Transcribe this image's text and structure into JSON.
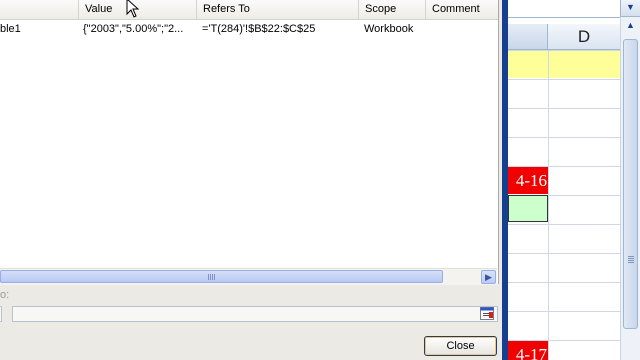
{
  "dialog": {
    "columns": [
      {
        "label": "Value"
      },
      {
        "label": "Refers To"
      },
      {
        "label": "Scope"
      },
      {
        "label": "Comment"
      }
    ],
    "rows": [
      {
        "name": "ble1",
        "value": "{\"2003\",\"5.00%\";\"2...",
        "refers_to": "='T(284)'!$B$22:$C$25",
        "scope": "Workbook",
        "comment": ""
      }
    ],
    "refers_to_label": "o:",
    "refers_to_value": "",
    "close_label": "Close"
  },
  "sheet": {
    "column_d": "D",
    "red_cell_1": "4-16",
    "red_cell_2": "4-17"
  },
  "colors": {
    "accent": "#163f90",
    "highlight": "#ffff99",
    "red_cell": "#f00000",
    "green_cell": "#ccffcc"
  },
  "icons": [
    "mouse-cursor-icon",
    "scroll-right-arrow-icon",
    "collapse-dialog-icon",
    "formula-expand-icon",
    "scroll-up-arrow-icon"
  ]
}
